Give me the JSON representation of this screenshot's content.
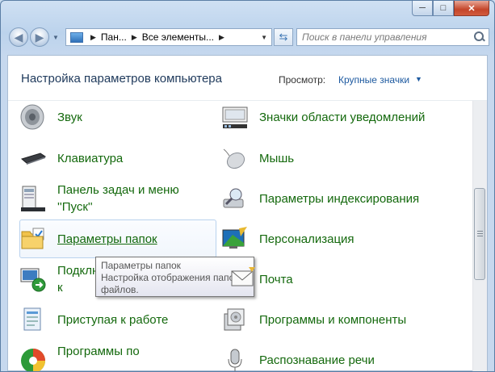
{
  "window": {
    "caption_buttons": {
      "minimize": "─",
      "maximize": "□",
      "close": "✕"
    }
  },
  "nav": {
    "back_icon": "arrow-left-icon",
    "forward_icon": "arrow-right-icon",
    "breadcrumb": [
      "Пан...",
      "Все элементы..."
    ],
    "refresh_icon": "refresh-icon",
    "search_placeholder": "Поиск в панели управления"
  },
  "header": {
    "title": "Настройка параметров компьютера",
    "view_label": "Просмотр:",
    "view_value": "Крупные значки"
  },
  "items": [
    {
      "label": "Звук",
      "icon": "speaker-icon",
      "column": 0
    },
    {
      "label": "Значки области уведомлений",
      "icon": "notification-area-icon",
      "column": 1
    },
    {
      "label": "Клавиатура",
      "icon": "keyboard-icon",
      "column": 0
    },
    {
      "label": "Мышь",
      "icon": "mouse-icon",
      "column": 1
    },
    {
      "label": "Панель задач и меню ''Пуск''",
      "icon": "taskbar-icon",
      "column": 0
    },
    {
      "label": "Параметры индексирования",
      "icon": "indexing-icon",
      "column": 1
    },
    {
      "label": "Параметры папок",
      "icon": "folder-options-icon",
      "column": 0,
      "hovered": true
    },
    {
      "label": "Персонализация",
      "icon": "personalization-icon",
      "column": 1
    },
    {
      "label": "Подключения к удаленным...",
      "icon": "remote-connection-icon",
      "column": 0
    },
    {
      "label": "Почта",
      "icon": "mail-icon",
      "column": 1
    },
    {
      "label": "Приступая к работе",
      "icon": "getting-started-icon",
      "column": 0
    },
    {
      "label": "Программы и компоненты",
      "icon": "programs-icon",
      "column": 1
    },
    {
      "label": "Программы по",
      "icon": "default-programs-icon",
      "column": 0
    },
    {
      "label": "Распознавание речи",
      "icon": "microphone-icon",
      "column": 1
    }
  ],
  "tooltip": {
    "title": "Параметры папок",
    "text": "Настройка отображения папок и файлов."
  },
  "colors": {
    "link_green": "#14690d",
    "title_blue": "#1e395b",
    "view_blue": "#1e5aa0"
  }
}
